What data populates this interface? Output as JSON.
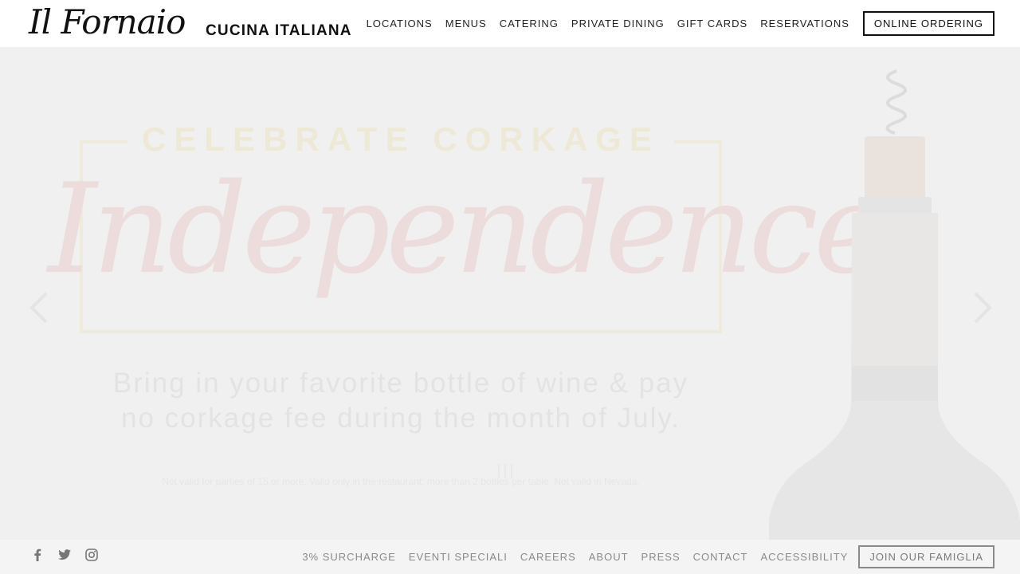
{
  "brand": {
    "logo_script": "Il Fornaio",
    "logo_sub": "CUCINA ITALIANA"
  },
  "nav": {
    "items": [
      "LOCATIONS",
      "MENUS",
      "CATERING",
      "PRIVATE DINING",
      "GIFT CARDS",
      "RESERVATIONS"
    ],
    "cta": "ONLINE ORDERING"
  },
  "hero": {
    "kicker": "CELEBRATE CORKAGE",
    "script_title": "Independence!",
    "body_line1": "Bring in your favorite bottle of wine & pay",
    "body_line2": "no corkage fee during the month of July.",
    "fine_print": "Not valid for parties of 15 or more. Valid only in the restaurant; more than 2 bottles per table. Not valid in Nevada."
  },
  "footer": {
    "social": [
      "facebook-icon",
      "twitter-icon",
      "instagram-icon"
    ],
    "links": [
      "3% SURCHARGE",
      "EVENTI SPECIALI",
      "CAREERS",
      "ABOUT",
      "PRESS",
      "CONTACT",
      "ACCESSIBILITY"
    ],
    "cta": "JOIN OUR FAMIGLIA"
  },
  "colors": {
    "header_bg": "#ffffff",
    "page_bg": "#f0f0f0",
    "footer_bg": "#f4f4f4",
    "text_dark": "#111111",
    "footer_text": "#8a8a8a"
  }
}
